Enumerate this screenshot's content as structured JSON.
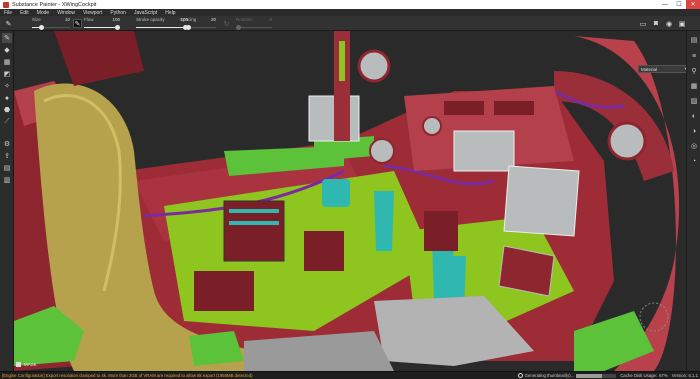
{
  "window": {
    "title": "Substance Painter - XWingCockpit",
    "controls": {
      "minimize": "—",
      "maximize": "☐",
      "close": "✕"
    }
  },
  "menu": [
    "File",
    "Edit",
    "Mode",
    "Window",
    "Viewport",
    "Python",
    "JavaScript",
    "Help"
  ],
  "tool_properties": {
    "size": {
      "label": "Size",
      "value": "10",
      "level": 0.22
    },
    "flow": {
      "label": "Flow",
      "value": "100",
      "level": 1.0
    },
    "stroke_opacity": {
      "label": "Stroke opacity",
      "value": "100",
      "level": 1.0
    },
    "spacing": {
      "label": "Spacing",
      "value": "20",
      "level": 0.2
    },
    "rotation": {
      "label": "Rotation",
      "value": "0",
      "level": 0.0
    }
  },
  "material_select": {
    "value": "Material",
    "arrow": "▾"
  },
  "mask": {
    "label": "MASK"
  },
  "status": {
    "message": "[Engine Configuration] Export resolution clamped to 4k. More than 2GB of VRAM are required to allow 8k export (1959MB detected)",
    "progress_label": "Generating thumbnail(s)...",
    "progress": 0.65,
    "cache": "Cache Disk Usage:",
    "cache_value": "67%",
    "version": "Version: 6.1.1"
  },
  "colors": {
    "hull_red": "#a8323c",
    "hull_dark": "#7a1f28",
    "panel_red": "#9b2b34",
    "lime": "#8fc51f",
    "bright_green": "#5bc23a",
    "teal": "#2fb8b0",
    "khaki": "#b6a24d",
    "grey_screen": "#b9bcbc",
    "purple": "#7b2aa0",
    "status_warning": "#e8a23a"
  },
  "icons": {
    "left_toolbar": [
      "brush-icon",
      "eraser-icon",
      "projection-icon",
      "geometry-decal-icon",
      "smudge-icon",
      "clone-icon",
      "polygon-fill-icon",
      "color-picker-icon",
      "bake-icon",
      "export-icon",
      "layers-icon",
      "texture-set-icon"
    ],
    "right_toolbar": [
      "shelf-icon",
      "layers-panel-icon",
      "properties-icon",
      "texture-set-settings-icon",
      "history-icon",
      "display-settings-icon",
      "shader-settings-icon",
      "log-icon",
      "viewer-settings-icon"
    ],
    "top_right": [
      "camera-icon",
      "screenshot-icon",
      "render-icon",
      "viewport-mode-icon"
    ]
  }
}
